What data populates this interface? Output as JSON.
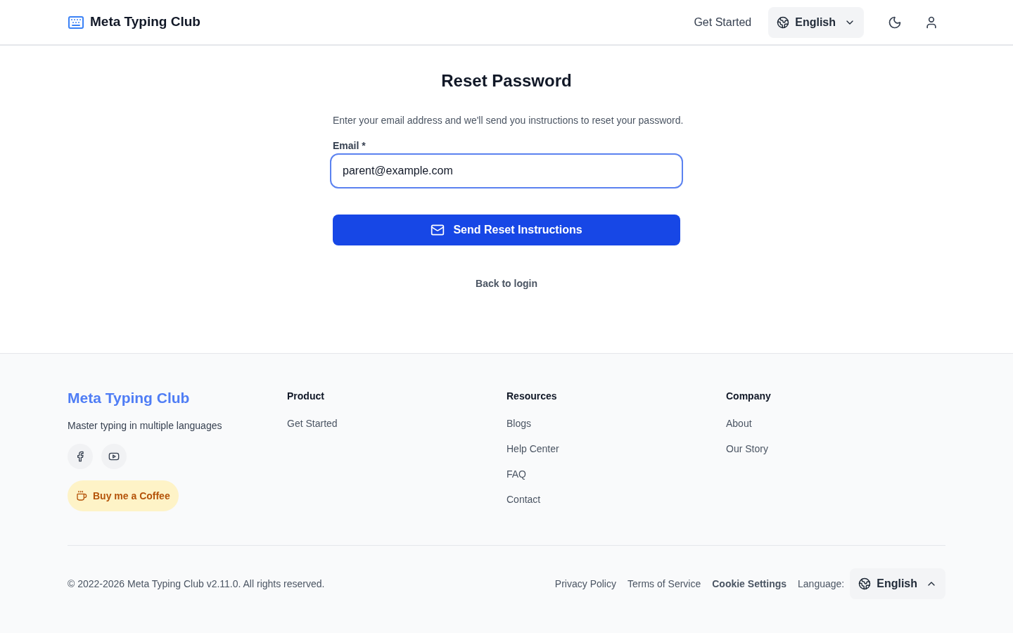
{
  "header": {
    "brand": "Meta Typing Club",
    "nav": [
      {
        "label": "Get Started"
      }
    ],
    "language": {
      "label": "English"
    }
  },
  "reset": {
    "title": "Reset Password",
    "description": "Enter your email address and we'll send you instructions to reset your password.",
    "email": {
      "label": "Email *",
      "value": "parent@example.com",
      "focused": true
    },
    "submit": "Send Reset Instructions",
    "back": "Back to login"
  },
  "footer": {
    "brand": "Meta Typing Club",
    "tagline": "Master typing in multiple languages",
    "social": [
      {
        "kind": "facebook"
      },
      {
        "kind": "youtube"
      }
    ],
    "coffee": "Buy me a Coffee",
    "columns": [
      {
        "heading": "Product",
        "links": [
          "Get Started"
        ]
      },
      {
        "heading": "Resources",
        "links": [
          "Blogs",
          "Help Center",
          "FAQ",
          "Contact"
        ]
      },
      {
        "heading": "Company",
        "links": [
          "About",
          "Our Story"
        ]
      }
    ],
    "copyright": "© 2022-2026 Meta Typing Club v2.11.0. All rights reserved.",
    "legal": [
      {
        "label": "Privacy Policy",
        "kind": "link"
      },
      {
        "label": "Terms of Service",
        "kind": "link"
      },
      {
        "label": "Cookie Settings",
        "kind": "button"
      }
    ],
    "language_label": "Language:",
    "language": {
      "label": "English"
    }
  }
}
